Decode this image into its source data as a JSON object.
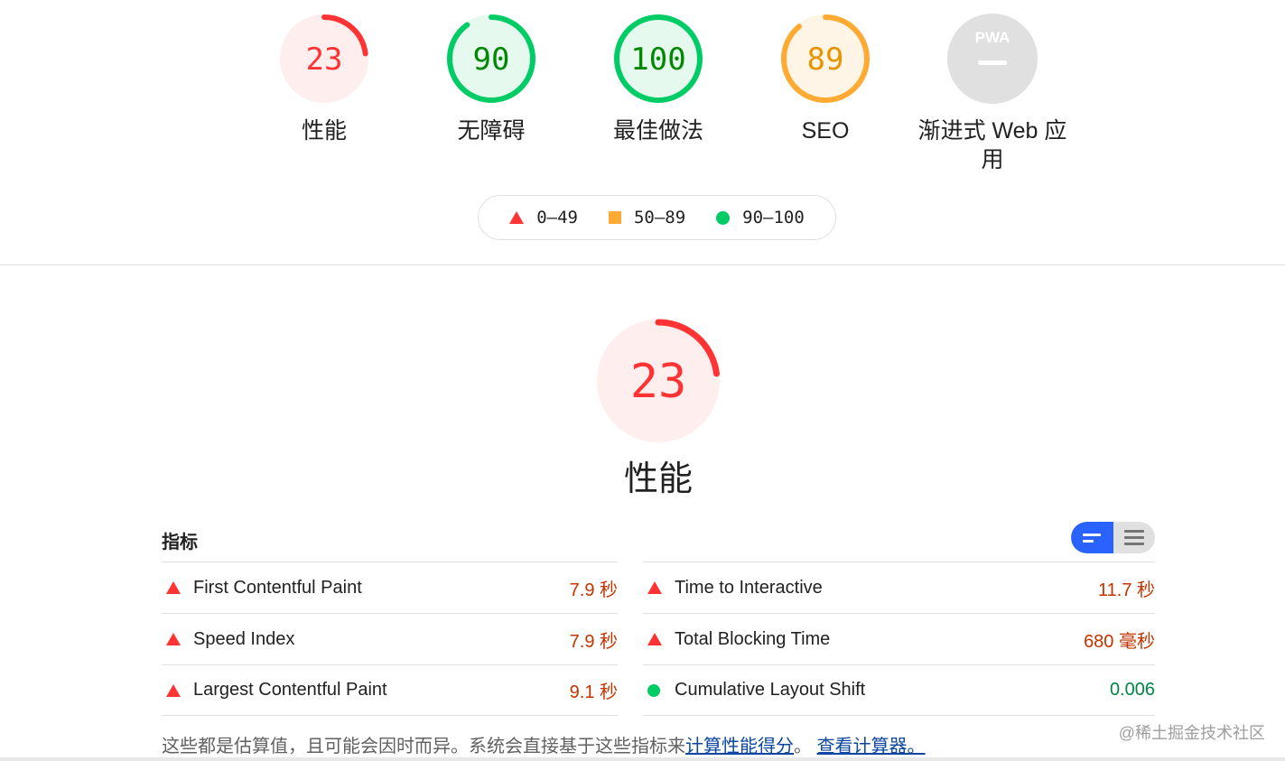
{
  "colors": {
    "fail": "#ff3333",
    "fail_bg": "#ffeeee",
    "average": "#ffaa33",
    "average_bg": "#fff5e6",
    "pass": "#00cc66",
    "pass_bg": "#e6f9ef",
    "na": "#e0e0e0",
    "link": "#0d47a1",
    "toggle_active": "#2962ff"
  },
  "gauges": [
    {
      "score": "23",
      "score_pct": 23,
      "label": "性能",
      "status": "fail"
    },
    {
      "score": "90",
      "score_pct": 90,
      "label": "无障碍",
      "status": "pass"
    },
    {
      "score": "100",
      "score_pct": 100,
      "label": "最佳做法",
      "status": "pass"
    },
    {
      "score": "89",
      "score_pct": 89,
      "label": "SEO",
      "status": "average"
    },
    {
      "score": "",
      "score_pct": 0,
      "label": "渐进式 Web 应用",
      "status": "na",
      "badge": "PWA"
    }
  ],
  "legend": [
    {
      "icon": "fail-triangle-icon",
      "range": "0–49"
    },
    {
      "icon": "average-square-icon",
      "range": "50–89"
    },
    {
      "icon": "pass-circle-icon",
      "range": "90–100"
    }
  ],
  "main_gauge": {
    "score": "23",
    "score_pct": 23,
    "label": "性能"
  },
  "metrics": {
    "header": "指标",
    "left": [
      {
        "title": "First Contentful Paint",
        "value": "7.9 秒",
        "status": "fail"
      },
      {
        "title": "Speed Index",
        "value": "7.9 秒",
        "status": "fail"
      },
      {
        "title": "Largest Contentful Paint",
        "value": "9.1 秒",
        "status": "fail"
      }
    ],
    "right": [
      {
        "title": "Time to Interactive",
        "value": "11.7 秒",
        "status": "fail"
      },
      {
        "title": "Total Blocking Time",
        "value": "680 毫秒",
        "status": "fail"
      },
      {
        "title": "Cumulative Layout Shift",
        "value": "0.006",
        "status": "pass"
      }
    ]
  },
  "note": {
    "text": "这些都是估算值，且可能会因时而异。系统会直接基于这些指标来",
    "link1": "计算性能得分",
    "sep": "。",
    "link2": "查看计算器。"
  },
  "watermark": "@稀土掘金技术社区"
}
